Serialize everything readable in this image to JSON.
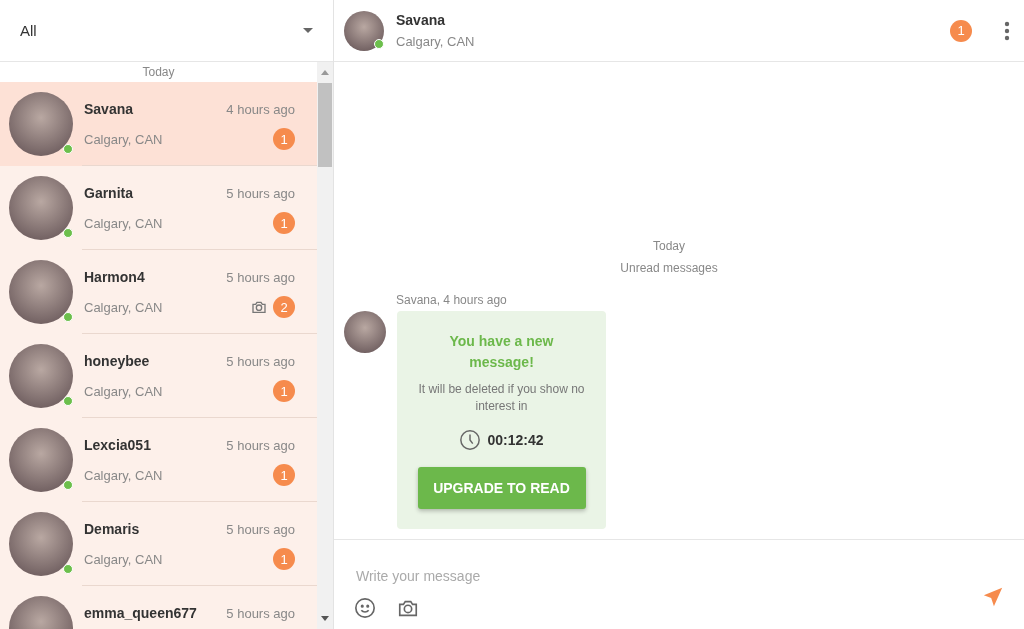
{
  "filter": {
    "value": "All"
  },
  "conversation_list": {
    "section": "Today",
    "items": [
      {
        "name": "Savana",
        "location": "Calgary, CAN",
        "time": "4 hours ago",
        "unread": "1",
        "online": true,
        "selected": true,
        "has_photo": false
      },
      {
        "name": "Garnita",
        "location": "Calgary, CAN",
        "time": "5 hours ago",
        "unread": "1",
        "online": true,
        "selected": false,
        "has_photo": false
      },
      {
        "name": "Harmon4",
        "location": "Calgary, CAN",
        "time": "5 hours ago",
        "unread": "2",
        "online": true,
        "selected": false,
        "has_photo": true
      },
      {
        "name": "honeybee",
        "location": "Calgary, CAN",
        "time": "5 hours ago",
        "unread": "1",
        "online": true,
        "selected": false,
        "has_photo": false
      },
      {
        "name": "Lexcia051",
        "location": "Calgary, CAN",
        "time": "5 hours ago",
        "unread": "1",
        "online": true,
        "selected": false,
        "has_photo": false
      },
      {
        "name": "Demaris",
        "location": "Calgary, CAN",
        "time": "5 hours ago",
        "unread": "1",
        "online": true,
        "selected": false,
        "has_photo": false
      },
      {
        "name": "emma_queen677",
        "time": "5 hours ago",
        "online": false,
        "selected": false,
        "has_photo": false
      }
    ]
  },
  "chat_header": {
    "name": "Savana",
    "location": "Calgary, CAN",
    "unread": "1",
    "online": true
  },
  "messages": {
    "day": "Today",
    "divider": "Unread messages",
    "sender_line": "Savana, 4 hours ago",
    "locked_message": {
      "title": "You have a new message!",
      "text": "It will be deleted if you show no interest in",
      "timer": "00:12:42",
      "button": "UPGRADE TO READ"
    }
  },
  "composer": {
    "placeholder": "Write your message"
  }
}
